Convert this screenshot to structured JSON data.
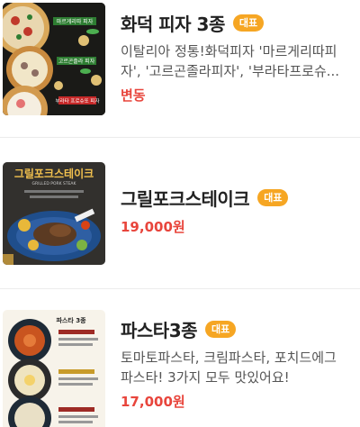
{
  "menu": {
    "items": [
      {
        "title": "화덕 피자 3종",
        "badge": "대표",
        "desc_line1": "이탈리아 정통!화덕피자 '마르게리따피",
        "desc_line2": "자', '고르곤졸라피자', '부라타프로슈...",
        "price": "변동",
        "thumb_texts": [
          "마르게리따 피자",
          "고르곤졸라 피자",
          "부라타 프로슈또 피자"
        ]
      },
      {
        "title": "그릴포크스테이크",
        "badge": "대표",
        "price": "19,000원",
        "thumb_texts": [
          "그릴포크스테이크",
          "GRILLED PORK STEAK"
        ]
      },
      {
        "title": "파스타3종",
        "badge": "대표",
        "desc_line1": "토마토파스타, 크림파스타, 포치드에그",
        "desc_line2": "파스타! 3가지 모두 맛있어요!",
        "price": "17,000원",
        "thumb_texts": [
          "파스타 3종"
        ]
      }
    ]
  },
  "colors": {
    "badge": "#f6a623",
    "price": "#e8453c",
    "divider": "#ececec"
  }
}
